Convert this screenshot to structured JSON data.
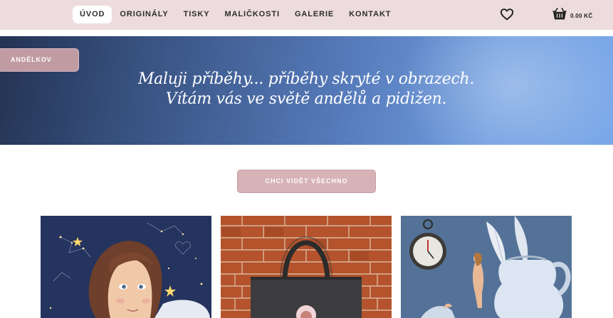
{
  "nav": {
    "items": [
      {
        "label": "ÚVOD",
        "active": true
      },
      {
        "label": "ORIGINÁLY",
        "active": false
      },
      {
        "label": "TISKY",
        "active": false
      },
      {
        "label": "MALIČKOSTI",
        "active": false
      },
      {
        "label": "GALERIE",
        "active": false
      },
      {
        "label": "KONTAKT",
        "active": false
      }
    ],
    "wishlist_icon": "heart-icon",
    "cart_icon": "basket-icon",
    "cart_total": "0.00 KČ"
  },
  "hero": {
    "tag": "ANDĚLKOV",
    "line1": "Maluji příběhy... příběhy skryté v obrazech.",
    "line2": "Vítám vás ve světě andělů a pidižen."
  },
  "cta": {
    "label": "CHCI VIDĚT VŠECHNO"
  },
  "colors": {
    "topbar": "#eddcde",
    "accent": "#d7b2b7",
    "tag": "#c19ba2",
    "hero_dark": "#243353",
    "hero_light": "#7aa8e8"
  }
}
